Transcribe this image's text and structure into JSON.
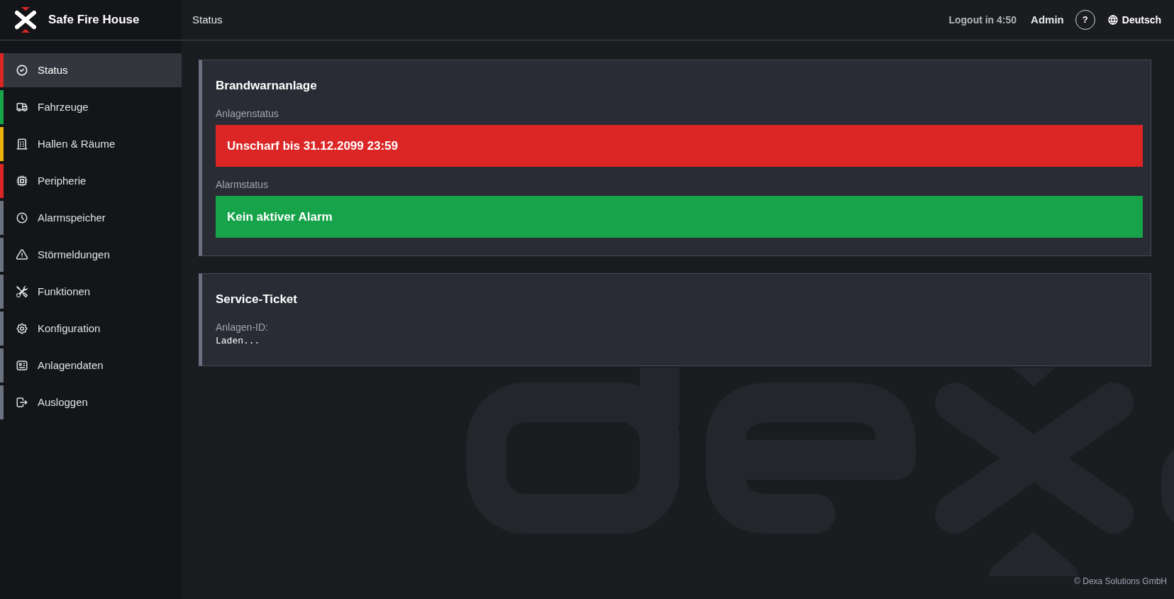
{
  "app": {
    "title": "Safe Fire House"
  },
  "header": {
    "title": "Status",
    "session_timer": "Logout in 4:50",
    "user": "Admin",
    "help": "?",
    "language": "Deutsch"
  },
  "sidebar": {
    "items": [
      {
        "label": "Status",
        "selected": true,
        "color": "#dc2626"
      },
      {
        "label": "Fahrzeuge",
        "selected": false,
        "color": "#16a34a"
      },
      {
        "label": "Hallen & Räume",
        "selected": false,
        "color": "#eab308"
      },
      {
        "label": "Peripherie",
        "selected": false,
        "color": "#dc2626"
      },
      {
        "label": "Alarmspeicher",
        "selected": false,
        "color": "#6b7280"
      },
      {
        "label": "Störmeldungen",
        "selected": false,
        "color": "#6b7280"
      },
      {
        "label": "Funktionen",
        "selected": false,
        "color": "#6b7280"
      },
      {
        "label": "Konfiguration",
        "selected": false,
        "color": "#6b7280"
      },
      {
        "label": "Anlagendaten",
        "selected": false,
        "color": "#6b7280"
      },
      {
        "label": "Ausloggen",
        "selected": false,
        "color": "#6b7280"
      }
    ]
  },
  "cards": [
    {
      "title": "Brandwarnanlage",
      "kind": "status",
      "fields": [
        {
          "label": "Anlagenstatus",
          "value": "Unscharf bis 31.12.2099 23:59",
          "color": "#dc2626"
        },
        {
          "label": "Alarmstatus",
          "value": "Kein aktiver Alarm",
          "color": "#16a34a"
        }
      ]
    },
    {
      "title": "Service-Ticket",
      "kind": "ticket",
      "fields": [
        {
          "label": "Anlagen-ID:",
          "value": "Laden..."
        }
      ]
    }
  ],
  "footer": {
    "copyright": "© Dexa Solutions GmbH"
  }
}
